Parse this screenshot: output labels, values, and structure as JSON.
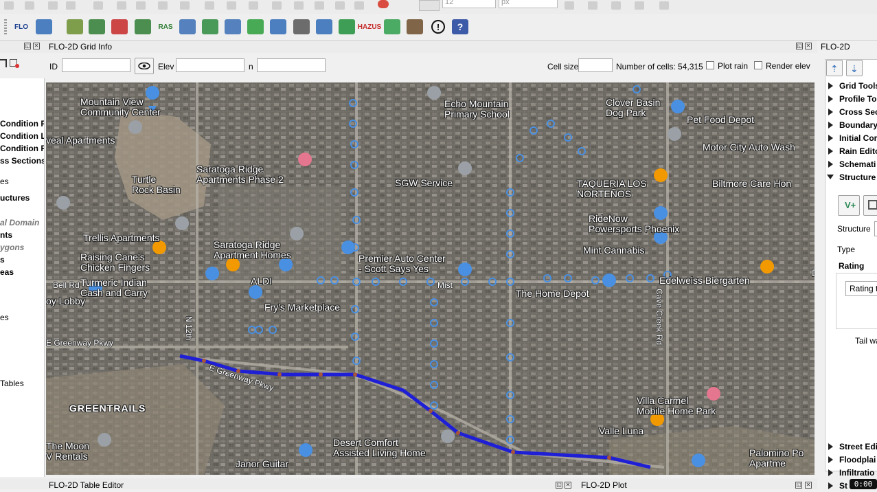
{
  "top_toolbar": {
    "font_size_value": "12",
    "unit_value": "px"
  },
  "flo_toolbar": {
    "buttons": [
      {
        "name": "flo-icon",
        "label": "FLO"
      },
      {
        "name": "flo2d-grid-icon",
        "label": ""
      },
      {
        "name": "import-gds-icon",
        "label": ""
      },
      {
        "name": "export-gds-icon",
        "label": ""
      },
      {
        "name": "import-ras-icon",
        "label": ""
      },
      {
        "name": "import-ras-geometry-icon",
        "label": ""
      },
      {
        "name": "ras-icon",
        "label": "RAS"
      },
      {
        "name": "grid-table-icon",
        "label": ""
      },
      {
        "name": "profile-icon",
        "label": ""
      },
      {
        "name": "grid-elevation-icon",
        "label": ""
      },
      {
        "name": "levee-icon",
        "label": ""
      },
      {
        "name": "help-book-icon",
        "label": ""
      },
      {
        "name": "database-icon",
        "label": ""
      },
      {
        "name": "chart-grid-icon",
        "label": ""
      },
      {
        "name": "terrain-icon",
        "label": ""
      },
      {
        "name": "hazus-icon",
        "label": "HAZUS"
      },
      {
        "name": "channel-icon",
        "label": ""
      },
      {
        "name": "house-icon",
        "label": ""
      },
      {
        "name": "warning-icon",
        "label": ""
      },
      {
        "name": "help-icon",
        "label": "?"
      }
    ]
  },
  "grid_info": {
    "title": "FLO-2D Grid Info",
    "id_label": "ID",
    "elev_label": "Elev",
    "n_label": "n",
    "cell_size_label": "Cell size",
    "num_cells_text": "Number of cells: 54,315",
    "plot_rain_label": "Plot rain",
    "render_elev_label": "Render elev"
  },
  "left_panel": {
    "items": [
      {
        "text": "Condition F",
        "bold": true
      },
      {
        "text": "Condition L",
        "bold": true
      },
      {
        "text": "Condition F",
        "bold": true
      },
      {
        "text": "ss Sections",
        "bold": true
      },
      {
        "text": "es",
        "bold": false
      },
      {
        "text": "uctures",
        "bold": true
      },
      {
        "text": "al Domain",
        "italic": true
      },
      {
        "text": "nts",
        "bold": true
      },
      {
        "text": "ygons",
        "italic": true
      },
      {
        "text": "s",
        "bold": true
      },
      {
        "text": "eas",
        "bold": true
      },
      {
        "text": "es",
        "bold": false
      },
      {
        "text": "Tables",
        "bold": false
      }
    ]
  },
  "map": {
    "places": [
      {
        "name": "mountain-view-label",
        "text": "Mountain View\nCommunity Center"
      },
      {
        "name": "veal-apartments-label",
        "text": "veal Apartments"
      },
      {
        "name": "turtle-rock-label",
        "text": "Turtle\nRock Basin"
      },
      {
        "name": "saratoga-ridge-2-label",
        "text": "Saratoga Ridge\nApartments Phase 2"
      },
      {
        "name": "echo-mountain-label",
        "text": "Echo Mountain\nPrimary School"
      },
      {
        "name": "sgw-service-label",
        "text": "SGW Service"
      },
      {
        "name": "clover-basin-label",
        "text": "Clover Basin\nDog Park"
      },
      {
        "name": "pet-food-depot-label",
        "text": "Pet Food Depot"
      },
      {
        "name": "motor-city-label",
        "text": "Motor City Auto Wash"
      },
      {
        "name": "taqueria-label",
        "text": "TAQUERIA LOS\nNORTEÑOS"
      },
      {
        "name": "biltmore-label",
        "text": "Biltmore Care Hon"
      },
      {
        "name": "ridenow-label",
        "text": "RideNow\nPowersports Phoenix"
      },
      {
        "name": "trellis-label",
        "text": "Trellis Apartments"
      },
      {
        "name": "saratoga-homes-label",
        "text": "Saratoga Ridge\nApartment Homes"
      },
      {
        "name": "premier-auto-label",
        "text": "Premier Auto Center\n- Scott Says Yes"
      },
      {
        "name": "mint-cannabis-label",
        "text": "Mint Cannabis"
      },
      {
        "name": "raising-canes-label",
        "text": "Raising Cane's\nChicken Fingers"
      },
      {
        "name": "aldi-label",
        "text": "ALDI"
      },
      {
        "name": "turmeric-label",
        "text": "Turmeric Indian\nCash and Carry"
      },
      {
        "name": "edelweiss-label",
        "text": "Edelweiss Biergarten"
      },
      {
        "name": "du-label",
        "text": "Du"
      },
      {
        "name": "home-depot-label",
        "text": "The Home Depot"
      },
      {
        "name": "lobby-label",
        "text": "oy Lobby"
      },
      {
        "name": "frys-label",
        "text": "Fry's Marketplace"
      },
      {
        "name": "greentrails-label",
        "text": "GREENTRAILS"
      },
      {
        "name": "villa-carmel-label",
        "text": "Villa Carmel\nMobile Home Park"
      },
      {
        "name": "valle-luna-label",
        "text": "Valle Luna"
      },
      {
        "name": "the-moon-label",
        "text": "The Moon\nV Rentals"
      },
      {
        "name": "desert-comfort-label",
        "text": "Desert Comfort\nAssisted Living Home"
      },
      {
        "name": "janor-guitar-label",
        "text": "Janor Guitar"
      },
      {
        "name": "palomino-label",
        "text": "Palomino Po\nApartme"
      }
    ],
    "streets": [
      {
        "name": "bell-rd-label",
        "text": "Bell Rd"
      },
      {
        "name": "greenway-label",
        "text": "E Greenway Pkwy"
      },
      {
        "name": "n-12th-label",
        "text": "N 12th"
      },
      {
        "name": "cave-creek-label",
        "text": "Cave Creek Rd"
      },
      {
        "name": "greenway-pkwy-label",
        "text": "E Greenway Pkwy"
      },
      {
        "name": "mist-label",
        "text": "Mist"
      }
    ]
  },
  "right_panel": {
    "title": "FLO-2D",
    "items": [
      "Grid Tools",
      "Profile To",
      "Cross Sec",
      "Boundary",
      "Initial Cor",
      "Rain Edito",
      "Schemati",
      "Structure"
    ],
    "structure_label": "Structure",
    "type_label": "Type",
    "rating_label": "Rating",
    "rating_value": "Rating ta",
    "tail_label": "Tail wa",
    "bottom_items": [
      "Street Edi",
      "Floodplai",
      "Infiltratio",
      "St"
    ]
  },
  "bottom": {
    "table_editor_title": "FLO-2D Table Editor",
    "plot_title": "FLO-2D Plot",
    "clock": "0:00"
  }
}
